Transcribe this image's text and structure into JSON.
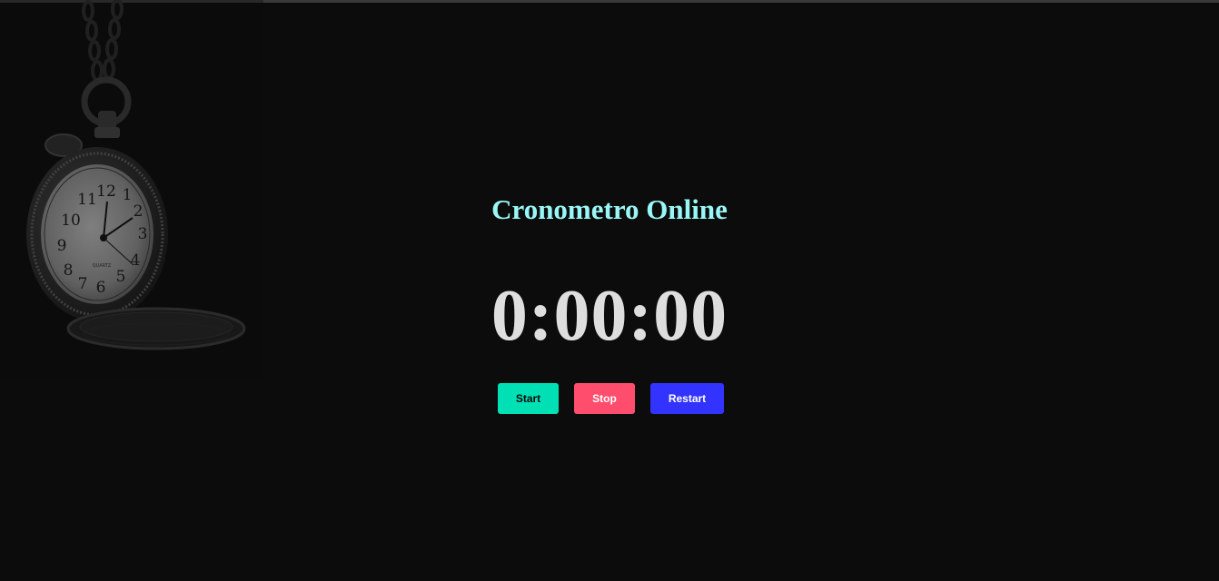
{
  "page": {
    "title": "Cronometro Online",
    "timer_display": "0:00:00"
  },
  "controls": {
    "start_label": "Start",
    "stop_label": "Stop",
    "restart_label": "Restart"
  },
  "decor": {
    "image": "pocket-watch",
    "watch_dial_numerals": [
      "12",
      "1",
      "2",
      "3",
      "4",
      "5",
      "6",
      "7",
      "8",
      "9",
      "10",
      "11"
    ],
    "watch_brand": "QUARTZ"
  },
  "colors": {
    "background": "#0c0c0c",
    "title": "#9af7f7",
    "timer": "#dedede",
    "start_button": "#00e0b5",
    "stop_button": "#ff4d6d",
    "restart_button": "#3333ff"
  }
}
